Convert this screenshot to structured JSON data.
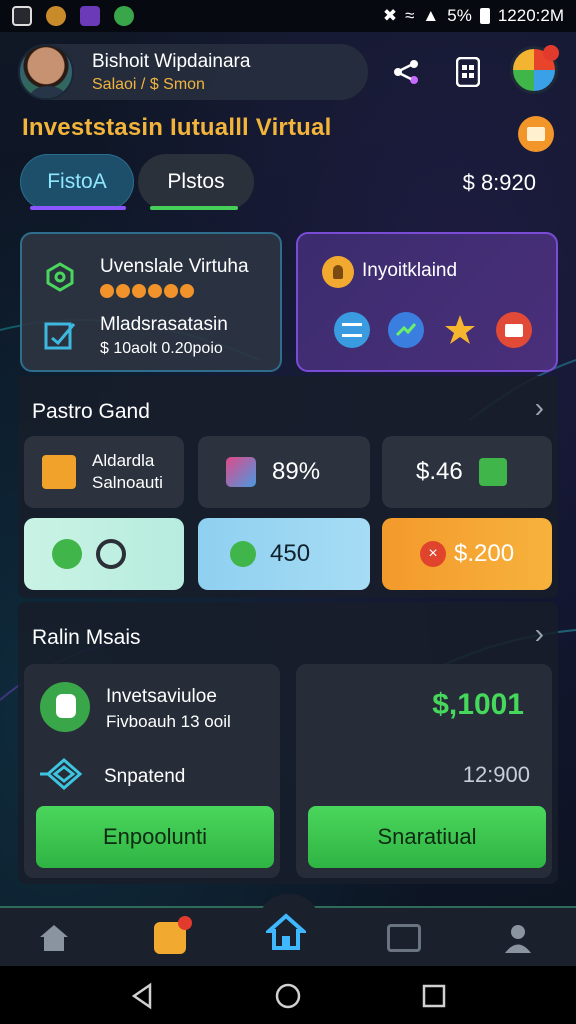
{
  "status_bar": {
    "battery": "5%",
    "time": "1220:2M"
  },
  "profile": {
    "name": "Bishoit Wipdainara",
    "subtitle": "Salaoi / $ Smon"
  },
  "app_title": "Investstasin Iutualll Virtual",
  "tabs": [
    {
      "label": "FistoA"
    },
    {
      "label": "Plstos"
    }
  ],
  "balance": "$ 8:920",
  "card_left": {
    "row1_title": "Uvenslale Virtuha",
    "row2_title": "Mladsrasatasin",
    "row2_sub": "$ 10aolt 0.20poio"
  },
  "card_right": {
    "title": "Inyoitklaind",
    "icons": [
      "wifi-icon",
      "chart-icon",
      "star-icon",
      "mail-icon"
    ]
  },
  "section_1": {
    "title": "Pastro Gand",
    "tiles": [
      {
        "line1": "Aldardla",
        "line2": "Salnoauti"
      },
      {
        "value": "89%"
      },
      {
        "value": "$.46"
      },
      {
        "value": ""
      },
      {
        "value": "450"
      },
      {
        "value": "$.200"
      }
    ]
  },
  "section_2": {
    "title": "Ralin Msais",
    "left": {
      "title": "Invetsaviuloe",
      "sub": "Fivboauh 13 ooil",
      "action": "Snpatend",
      "button": "Enpoolunti"
    },
    "right": {
      "amount": "$,1001",
      "time": "12:900",
      "button": "Snaratiual"
    }
  },
  "colors": {
    "accent_gold": "#f2b43a",
    "accent_green": "#46d85a",
    "accent_purple": "#8a57ff",
    "accent_cyan": "#8fe6ff"
  }
}
